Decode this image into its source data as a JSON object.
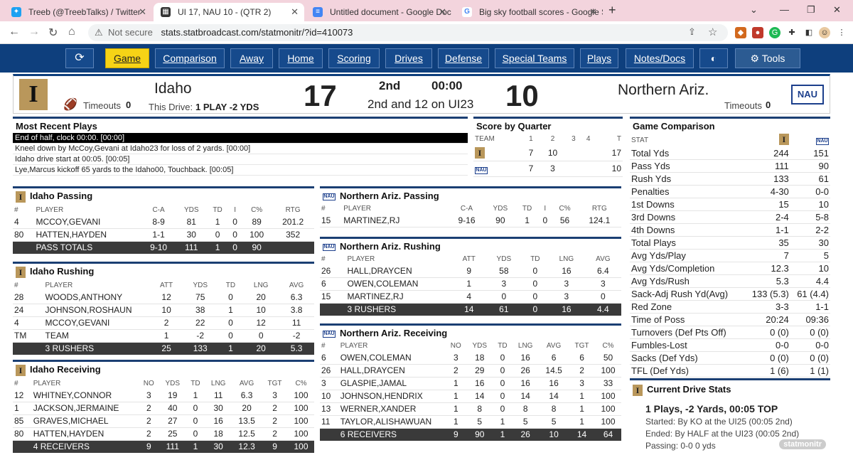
{
  "browser": {
    "tabs": [
      {
        "title": "Treeb (@TreebTalks) / Twitter",
        "icon": "twitter-bird-icon"
      },
      {
        "title": "UI 17, NAU 10 - (QTR 2)",
        "icon": "statbroadcast-icon"
      },
      {
        "title": "Untitled document - Google Doc",
        "icon": "google-docs-icon"
      },
      {
        "title": "Big sky football scores - Google S",
        "icon": "google-icon"
      }
    ],
    "address": {
      "security": "Not secure",
      "url": "stats.statbroadcast.com/statmonitr/?id=410073"
    }
  },
  "nav": {
    "items": [
      "Game",
      "Comparison",
      "Away",
      "Home",
      "Scoring",
      "Drives",
      "Defense",
      "Special Teams",
      "Plays",
      "Notes/Docs"
    ],
    "tools": "Tools",
    "active": "Game"
  },
  "score": {
    "home": {
      "name": "Idaho",
      "score": "17",
      "timeouts_label": "Timeouts",
      "timeouts": "0"
    },
    "away": {
      "name": "Northern Ariz.",
      "score": "10",
      "timeouts_label": "Timeouts",
      "timeouts": "0",
      "logo_text": "NAU"
    },
    "drive_label": "This Drive:",
    "drive_value": "1 PLAY -2 YDS",
    "period": "2nd",
    "clock": "00:00",
    "situation": "2nd and 12 on UI23"
  },
  "recent_plays": {
    "title": "Most Recent Plays",
    "items": [
      "End of half, clock 00:00. [00:00]",
      "Kneel down by McCoy,Gevani at Idaho23 for loss of 2 yards. [00:00]",
      "Idaho drive start at 00:05. [00:05]",
      "Lye,Marcus kickoff 65 yards to the Idaho00, Touchback. [00:05]"
    ]
  },
  "quarter_scores": {
    "title": "Score by Quarter",
    "headers": [
      "TEAM",
      "1",
      "2",
      "3",
      "4",
      "T"
    ],
    "rows": [
      {
        "q1": "7",
        "q2": "10",
        "q3": "",
        "q4": "",
        "t": "17"
      },
      {
        "q1": "7",
        "q2": "3",
        "q3": "",
        "q4": "",
        "t": "10"
      }
    ]
  },
  "comparison": {
    "title": "Game Comparison",
    "header": "STAT",
    "rows": [
      [
        "Total Yds",
        "244",
        "151"
      ],
      [
        "Pass Yds",
        "111",
        "90"
      ],
      [
        "Rush Yds",
        "133",
        "61"
      ],
      [
        "Penalties",
        "4-30",
        "0-0"
      ],
      [
        "1st Downs",
        "15",
        "10"
      ],
      [
        "3rd Downs",
        "2-4",
        "5-8"
      ],
      [
        "4th Downs",
        "1-1",
        "2-2"
      ],
      [
        "Total Plays",
        "35",
        "30"
      ],
      [
        "Avg Yds/Play",
        "7",
        "5"
      ],
      [
        "Avg Yds/Completion",
        "12.3",
        "10"
      ],
      [
        "Avg Yds/Rush",
        "5.3",
        "4.4"
      ],
      [
        "Sack-Adj Rush Yd(Avg)",
        "133 (5.3)",
        "61 (4.4)"
      ],
      [
        "Red Zone",
        "3-3",
        "1-1"
      ],
      [
        "Time of Poss",
        "20:24",
        "09:36"
      ],
      [
        "Turnovers (Def Pts Off)",
        "0 (0)",
        "0 (0)"
      ],
      [
        "Fumbles-Lost",
        "0-0",
        "0-0"
      ],
      [
        "Sacks (Def Yds)",
        "0 (0)",
        "0 (0)"
      ],
      [
        "TFL (Def Yds)",
        "1 (6)",
        "1 (1)"
      ]
    ]
  },
  "idaho_passing": {
    "title": "Idaho Passing",
    "headers": [
      "#",
      "PLAYER",
      "C-A",
      "YDS",
      "TD",
      "I",
      "C%",
      "RTG"
    ],
    "rows": [
      [
        "4",
        "MCCOY,GEVANI",
        "8-9",
        "81",
        "1",
        "0",
        "89",
        "201.2"
      ],
      [
        "80",
        "HATTEN,HAYDEN",
        "1-1",
        "30",
        "0",
        "0",
        "100",
        "352"
      ]
    ],
    "total": [
      "",
      "PASS TOTALS",
      "9-10",
      "111",
      "1",
      "0",
      "90",
      ""
    ]
  },
  "idaho_rushing": {
    "title": "Idaho Rushing",
    "headers": [
      "#",
      "PLAYER",
      "ATT",
      "YDS",
      "TD",
      "LNG",
      "AVG"
    ],
    "rows": [
      [
        "28",
        "WOODS,ANTHONY",
        "12",
        "75",
        "0",
        "20",
        "6.3"
      ],
      [
        "24",
        "JOHNSON,ROSHAUN",
        "10",
        "38",
        "1",
        "10",
        "3.8"
      ],
      [
        "4",
        "MCCOY,GEVANI",
        "2",
        "22",
        "0",
        "12",
        "11"
      ],
      [
        "TM",
        "TEAM",
        "1",
        "-2",
        "0",
        "0",
        "-2"
      ]
    ],
    "total": [
      "",
      "3 RUSHERS",
      "25",
      "133",
      "1",
      "20",
      "5.3"
    ]
  },
  "idaho_receiving": {
    "title": "Idaho Receiving",
    "headers": [
      "#",
      "PLAYER",
      "NO",
      "YDS",
      "TD",
      "LNG",
      "AVG",
      "TGT",
      "C%"
    ],
    "rows": [
      [
        "12",
        "WHITNEY,CONNOR",
        "3",
        "19",
        "1",
        "11",
        "6.3",
        "3",
        "100"
      ],
      [
        "1",
        "JACKSON,JERMAINE",
        "2",
        "40",
        "0",
        "30",
        "20",
        "2",
        "100"
      ],
      [
        "85",
        "GRAVES,MICHAEL",
        "2",
        "27",
        "0",
        "16",
        "13.5",
        "2",
        "100"
      ],
      [
        "80",
        "HATTEN,HAYDEN",
        "2",
        "25",
        "0",
        "18",
        "12.5",
        "2",
        "100"
      ]
    ],
    "total": [
      "",
      "4 RECEIVERS",
      "9",
      "111",
      "1",
      "30",
      "12.3",
      "9",
      "100"
    ]
  },
  "nau_passing": {
    "title": "Northern Ariz. Passing",
    "headers": [
      "#",
      "PLAYER",
      "C-A",
      "YDS",
      "TD",
      "I",
      "C%",
      "RTG"
    ],
    "rows": [
      [
        "15",
        "MARTINEZ,RJ",
        "9-16",
        "90",
        "1",
        "0",
        "56",
        "124.1"
      ]
    ]
  },
  "nau_rushing": {
    "title": "Northern Ariz. Rushing",
    "headers": [
      "#",
      "PLAYER",
      "ATT",
      "YDS",
      "TD",
      "LNG",
      "AVG"
    ],
    "rows": [
      [
        "26",
        "HALL,DRAYCEN",
        "9",
        "58",
        "0",
        "16",
        "6.4"
      ],
      [
        "6",
        "OWEN,COLEMAN",
        "1",
        "3",
        "0",
        "3",
        "3"
      ],
      [
        "15",
        "MARTINEZ,RJ",
        "4",
        "0",
        "0",
        "3",
        "0"
      ]
    ],
    "total": [
      "",
      "3 RUSHERS",
      "14",
      "61",
      "0",
      "16",
      "4.4"
    ]
  },
  "nau_receiving": {
    "title": "Northern Ariz. Receiving",
    "headers": [
      "#",
      "PLAYER",
      "NO",
      "YDS",
      "TD",
      "LNG",
      "AVG",
      "TGT",
      "C%"
    ],
    "rows": [
      [
        "6",
        "OWEN,COLEMAN",
        "3",
        "18",
        "0",
        "16",
        "6",
        "6",
        "50"
      ],
      [
        "26",
        "HALL,DRAYCEN",
        "2",
        "29",
        "0",
        "26",
        "14.5",
        "2",
        "100"
      ],
      [
        "3",
        "GLASPIE,JAMAL",
        "1",
        "16",
        "0",
        "16",
        "16",
        "3",
        "33"
      ],
      [
        "10",
        "JOHNSON,HENDRIX",
        "1",
        "14",
        "0",
        "14",
        "14",
        "1",
        "100"
      ],
      [
        "13",
        "WERNER,XANDER",
        "1",
        "8",
        "0",
        "8",
        "8",
        "1",
        "100"
      ],
      [
        "11",
        "TAYLOR,ALISHAWUAN",
        "1",
        "5",
        "1",
        "5",
        "5",
        "1",
        "100"
      ]
    ],
    "total": [
      "",
      "6 RECEIVERS",
      "9",
      "90",
      "1",
      "26",
      "10",
      "14",
      "64"
    ]
  },
  "drive_stats": {
    "title": "Current Drive Stats",
    "summary": "1 Plays, -2 Yards, 00:05 TOP",
    "started": "Started: By KO at the UI25 (00:05 2nd)",
    "ended": "Ended: By HALF at the UI23 (00:05 2nd)",
    "passing": "Passing: 0-0 0 yds"
  },
  "watermark": "statmonitr"
}
